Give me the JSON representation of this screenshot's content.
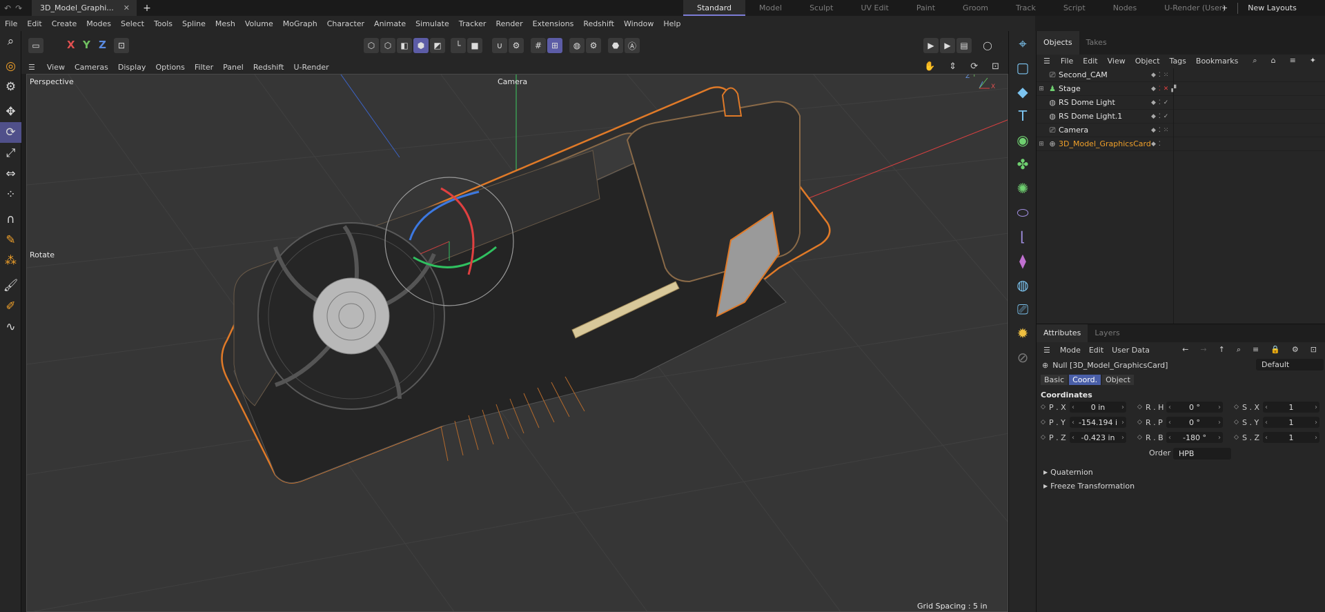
{
  "title_bar": {
    "doc_tab": "3D_Model_Graphi...",
    "layouts": [
      "Standard",
      "Model",
      "Sculpt",
      "UV Edit",
      "Paint",
      "Groom",
      "Track",
      "Script",
      "Nodes",
      "U-Render (User)"
    ],
    "active_layout": "Standard",
    "new_layouts": "New Layouts"
  },
  "menu": [
    "File",
    "Edit",
    "Create",
    "Modes",
    "Select",
    "Tools",
    "Spline",
    "Mesh",
    "Volume",
    "MoGraph",
    "Character",
    "Animate",
    "Simulate",
    "Tracker",
    "Render",
    "Extensions",
    "Redshift",
    "Window",
    "Help"
  ],
  "toolbar": {
    "axis_x": "X",
    "axis_y": "Y",
    "axis_z": "Z"
  },
  "viewport_menu": [
    "View",
    "Cameras",
    "Display",
    "Options",
    "Filter",
    "Panel",
    "Redshift",
    "U-Render"
  ],
  "viewport": {
    "name": "Perspective",
    "camera": "Camera",
    "tool": "Rotate",
    "grid_spacing": "Grid Spacing : 5 in",
    "gizmo_z": "Z",
    "gizmo_y": "Y",
    "gizmo_x": "X"
  },
  "objects_panel": {
    "tabs": [
      "Objects",
      "Takes"
    ],
    "menu": [
      "File",
      "Edit",
      "View",
      "Object",
      "Tags",
      "Bookmarks"
    ],
    "items": [
      {
        "name": "Second_CAM",
        "icon": "camera-icon"
      },
      {
        "name": "Stage",
        "icon": "stage-icon"
      },
      {
        "name": "RS Dome Light",
        "icon": "dome-light-icon"
      },
      {
        "name": "RS Dome Light.1",
        "icon": "dome-light-icon"
      },
      {
        "name": "Camera",
        "icon": "camera-icon"
      },
      {
        "name": "3D_Model_GraphicsCard",
        "icon": "null-icon",
        "selected": true
      }
    ]
  },
  "attributes_panel": {
    "tabs": [
      "Attributes",
      "Layers"
    ],
    "menu": [
      "Mode",
      "Edit",
      "User Data"
    ],
    "object_label": "Null [3D_Model_GraphicsCard]",
    "preset": "Default",
    "subtabs": [
      "Basic",
      "Coord.",
      "Object"
    ],
    "active_subtab": "Coord.",
    "section": "Coordinates",
    "position": [
      {
        "label": "P . X",
        "value": "0 in"
      },
      {
        "label": "P . Y",
        "value": "-154.194 i"
      },
      {
        "label": "P . Z",
        "value": "-0.423 in"
      }
    ],
    "rotation": [
      {
        "label": "R . H",
        "value": "0 °"
      },
      {
        "label": "R . P",
        "value": "0 °"
      },
      {
        "label": "R . B",
        "value": "-180 °"
      }
    ],
    "scale": [
      {
        "label": "S . X",
        "value": "1"
      },
      {
        "label": "S . Y",
        "value": "1"
      },
      {
        "label": "S . Z",
        "value": "1"
      }
    ],
    "order_label": "Order",
    "order_value": "HPB",
    "folds": [
      "Quaternion",
      "Freeze Transformation"
    ]
  },
  "colors": {
    "accent": "#5c5ca6",
    "selection": "#f0a02a",
    "viewport_bg": "#363636"
  }
}
